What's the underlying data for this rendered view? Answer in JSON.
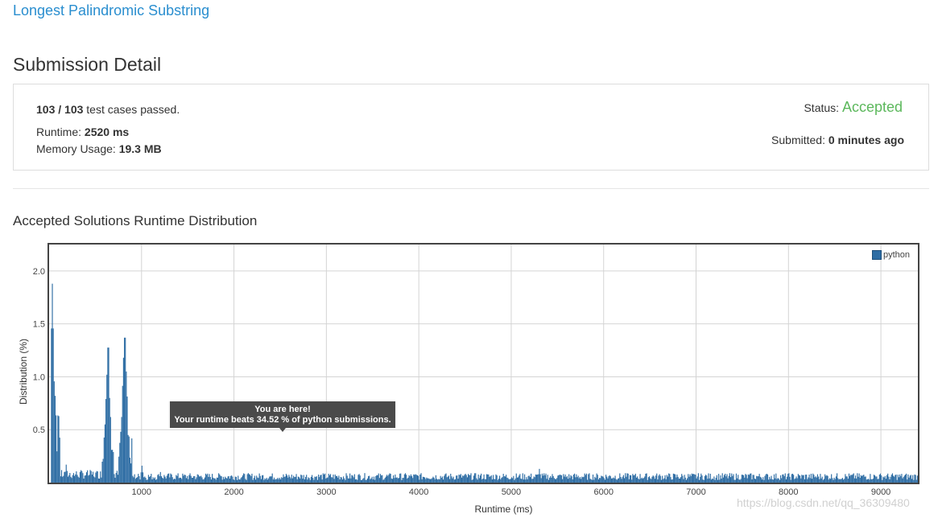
{
  "problem": {
    "link_text": "Longest Palindromic Substring"
  },
  "page": {
    "title": "Submission Detail"
  },
  "detail": {
    "passed_count": "103",
    "separator": " / ",
    "total_count": "103",
    "tests_suffix": " test cases passed.",
    "runtime_label": "Runtime: ",
    "runtime_value": "2520 ms",
    "memory_label": "Memory Usage: ",
    "memory_value": "19.3 MB",
    "status_label": "Status: ",
    "status_value": "Accepted",
    "submitted_label": "Submitted: ",
    "submitted_value": "0 minutes ago"
  },
  "colors": {
    "link": "#2a8ecf",
    "accepted": "#5cb85c",
    "bar": "#2e6da4",
    "tooltip_bg": "#4a4a4a"
  },
  "distribution": {
    "section_title": "Accepted Solutions Runtime Distribution",
    "legend_label": "python",
    "tooltip_line1": "You are here!",
    "tooltip_line2": "Your runtime beats 34.52 % of python submissions."
  },
  "chart_data": {
    "type": "bar",
    "xlabel": "Runtime (ms)",
    "ylabel": "Distribution (%)",
    "xlim": [
      0,
      9400
    ],
    "ylim": [
      0,
      2.25
    ],
    "x_ticks": [
      1000,
      2000,
      3000,
      4000,
      5000,
      6000,
      7000,
      8000,
      9000
    ],
    "y_ticks": [
      0.5,
      1.0,
      1.5,
      2.0
    ],
    "x_tick_labels": [
      "1000",
      "2000",
      "3000",
      "4000",
      "5000",
      "6000",
      "7000",
      "8000",
      "9000"
    ],
    "y_tick_labels": [
      "0.5",
      "1.0",
      "1.5",
      "2.0"
    ],
    "grid": true,
    "legend_position": "top-right",
    "series": [
      {
        "name": "python",
        "peaks": [
          {
            "x": 30,
            "y": 1.88
          },
          {
            "x": 45,
            "y": 1.02
          },
          {
            "x": 60,
            "y": 0.82
          },
          {
            "x": 70,
            "y": 0.3
          },
          {
            "x": 90,
            "y": 0.18
          },
          {
            "x": 180,
            "y": 0.17
          },
          {
            "x": 600,
            "y": 0.55
          },
          {
            "x": 620,
            "y": 1.02
          },
          {
            "x": 635,
            "y": 1.36
          },
          {
            "x": 650,
            "y": 0.8
          },
          {
            "x": 665,
            "y": 0.35
          },
          {
            "x": 780,
            "y": 0.62
          },
          {
            "x": 800,
            "y": 1.18
          },
          {
            "x": 815,
            "y": 1.46
          },
          {
            "x": 830,
            "y": 1.05
          },
          {
            "x": 850,
            "y": 0.45
          },
          {
            "x": 1000,
            "y": 0.16
          },
          {
            "x": 1200,
            "y": 0.1
          },
          {
            "x": 5300,
            "y": 0.13
          }
        ],
        "tail_level": 0.06
      }
    ],
    "marker": {
      "x": 2520,
      "label": "You are here!"
    }
  },
  "watermark": "https://blog.csdn.net/qq_36309480"
}
